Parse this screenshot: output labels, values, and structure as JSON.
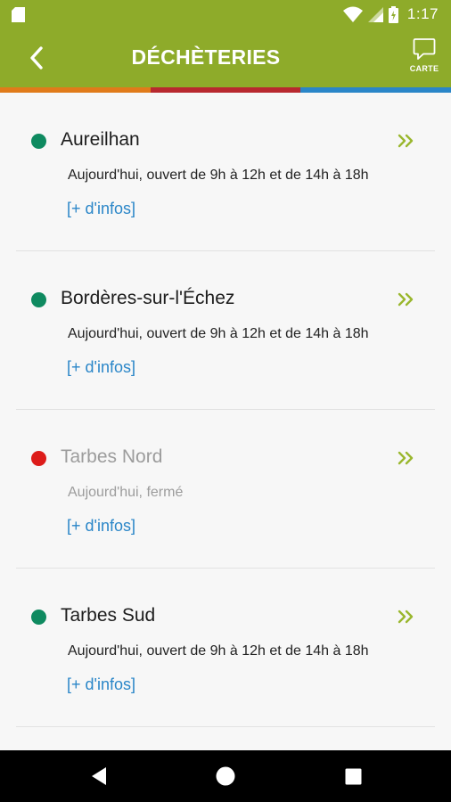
{
  "status_bar": {
    "time": "1:17",
    "color": "#8eab2a"
  },
  "app_bar": {
    "title": "DÉCHÈTERIES",
    "map_label": "CARTE",
    "color": "#8eab2a"
  },
  "stripe_colors": [
    "#e07b1a",
    "#b8292f",
    "#2a86c8"
  ],
  "status_colors": {
    "open": "#0f8a60",
    "closed": "#dd1c1a"
  },
  "more_label": "[+ d'infos]",
  "centers": [
    {
      "name": "Aureilhan",
      "status": "open",
      "hours": "Aujourd'hui, ouvert de 9h à 12h et de 14h à 18h"
    },
    {
      "name": "Bordères-sur-l'Échez",
      "status": "open",
      "hours": "Aujourd'hui, ouvert de 9h à 12h et de 14h à 18h"
    },
    {
      "name": "Tarbes Nord",
      "status": "closed",
      "hours": "Aujourd'hui, fermé"
    },
    {
      "name": "Tarbes Sud",
      "status": "open",
      "hours": "Aujourd'hui, ouvert de 9h à 12h et de 14h à 18h"
    }
  ],
  "icons": {
    "status": [
      "sd-card-icon",
      "wifi-icon",
      "signal-icon",
      "battery-icon"
    ],
    "app": [
      "back-arrow-icon",
      "map-bubble-icon",
      "double-chevron-icon"
    ],
    "nav": [
      "back-triangle-icon",
      "home-circle-icon",
      "recents-square-icon"
    ]
  }
}
